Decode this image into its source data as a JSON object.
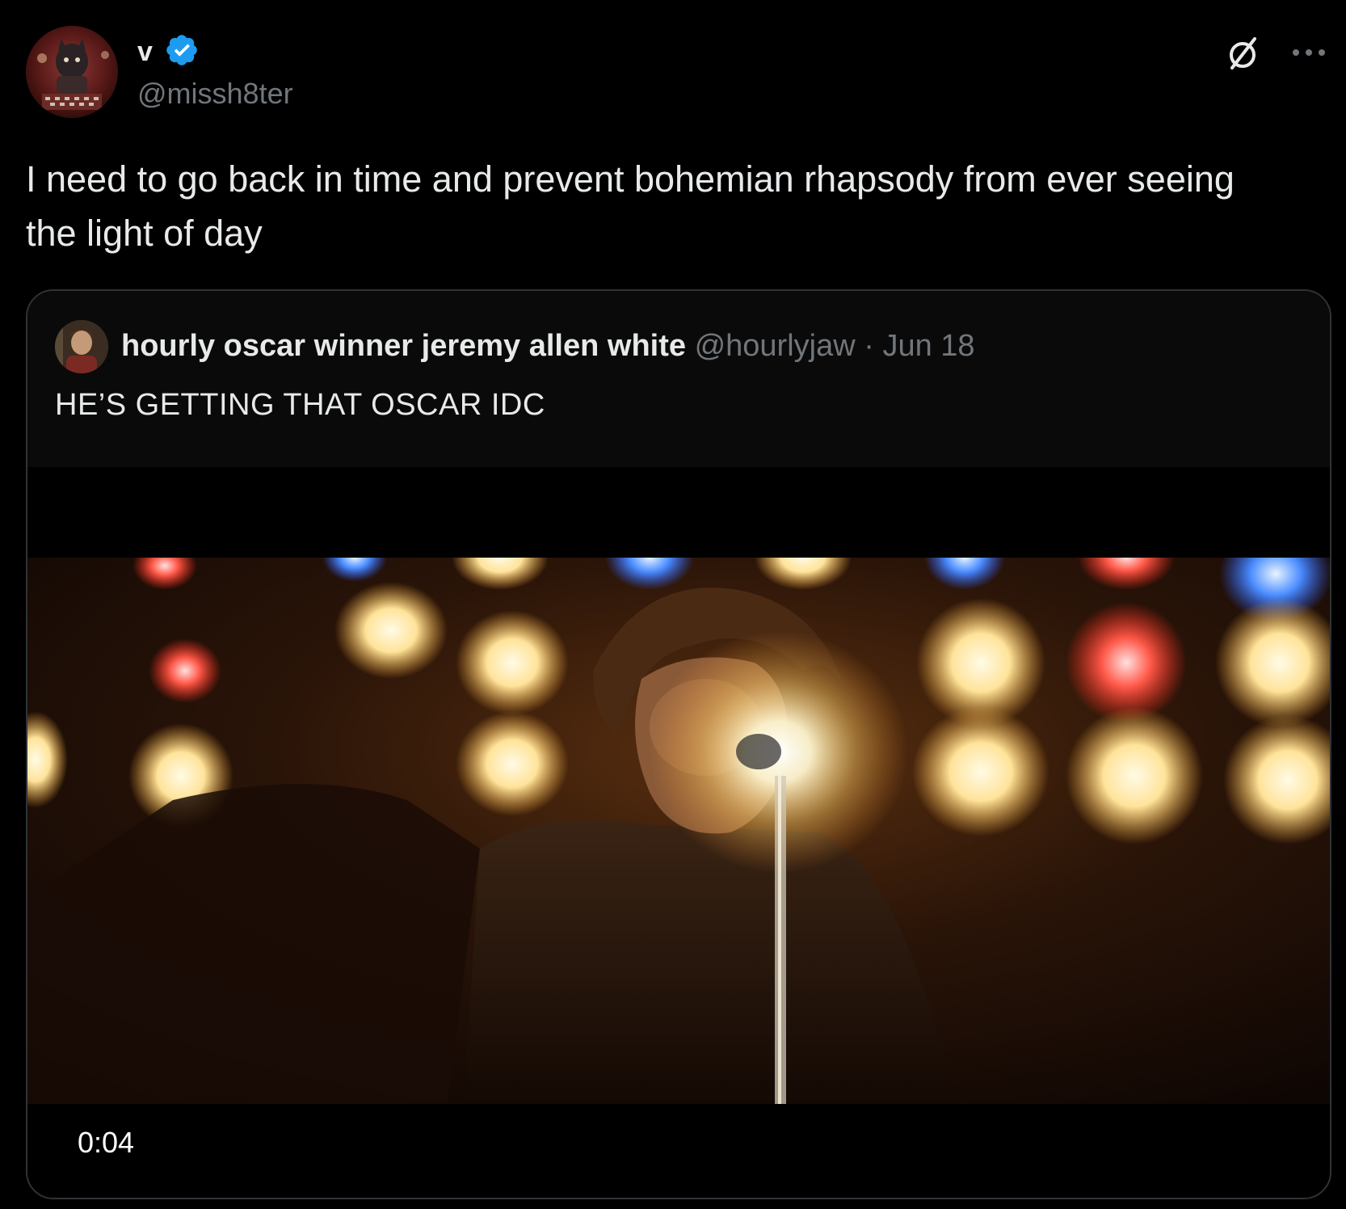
{
  "author": {
    "name": "v",
    "handle": "@missh8ter",
    "verified": true,
    "verified_color": "#1d9bf0"
  },
  "tweet": {
    "text": "I need to go back in time and prevent bohemian rhapsody from ever seeing the light of day"
  },
  "actions": {
    "grok_icon": "grok-slash-circle-icon",
    "more_icon": "more-horizontal-icon"
  },
  "quote": {
    "name": "hourly oscar winner jeremy allen white",
    "handle": "@hourlyjaw",
    "separator": "·",
    "date": "Jun 18",
    "text": "HE’S GETTING THAT OSCAR IDC"
  },
  "video": {
    "timer": "0:04"
  },
  "colors": {
    "background": "#000000",
    "text_primary": "#e7e9ea",
    "text_secondary": "#71767b",
    "border": "#2f3336"
  }
}
